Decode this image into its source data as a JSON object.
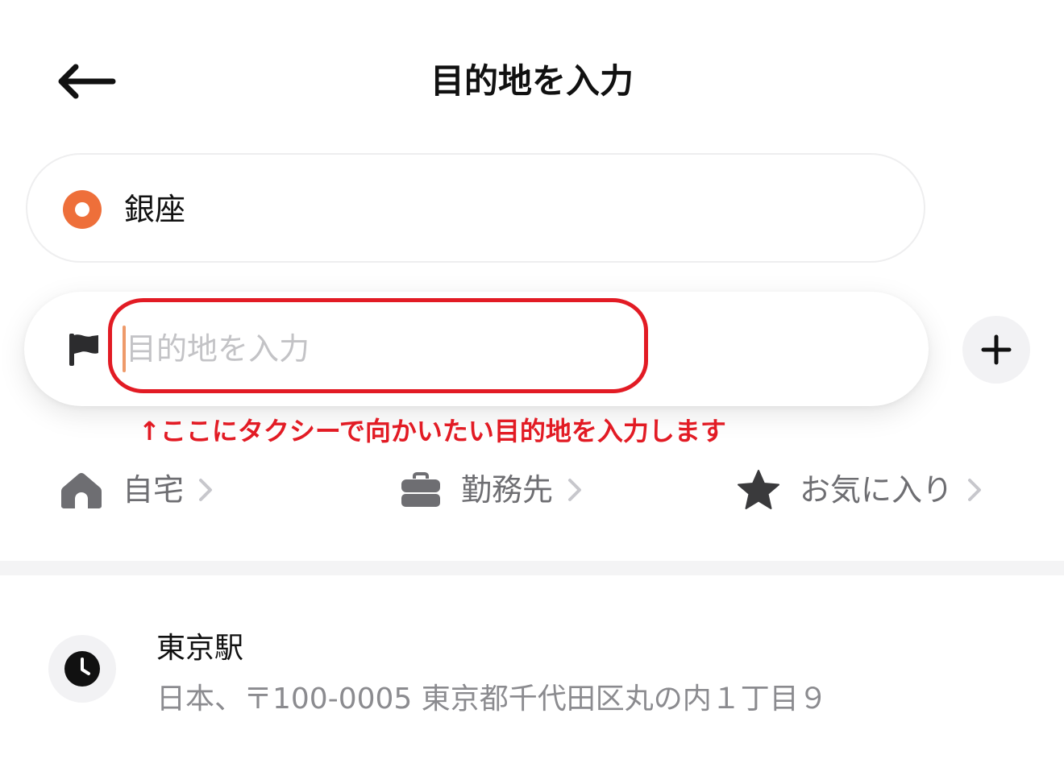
{
  "header": {
    "title": "目的地を入力",
    "back_icon": "arrow-left-icon"
  },
  "origin": {
    "value": "銀座",
    "icon": "origin-circle-icon",
    "icon_color": "#ee6f3a"
  },
  "destination": {
    "placeholder": "目的地を入力",
    "value": "",
    "icon": "flag-icon",
    "add_icon": "plus-icon"
  },
  "annotation": {
    "text": "↑ここにタクシーで向かいたい目的地を入力します",
    "color": "#e21b24"
  },
  "shortcuts": [
    {
      "label": "自宅",
      "icon": "home-icon"
    },
    {
      "label": "勤務先",
      "icon": "briefcase-icon"
    },
    {
      "label": "お気に入り",
      "icon": "star-icon"
    }
  ],
  "history": [
    {
      "title": "東京駅",
      "address": "日本、〒100-0005 東京都千代田区丸の内１丁目９",
      "icon": "clock-icon"
    }
  ]
}
